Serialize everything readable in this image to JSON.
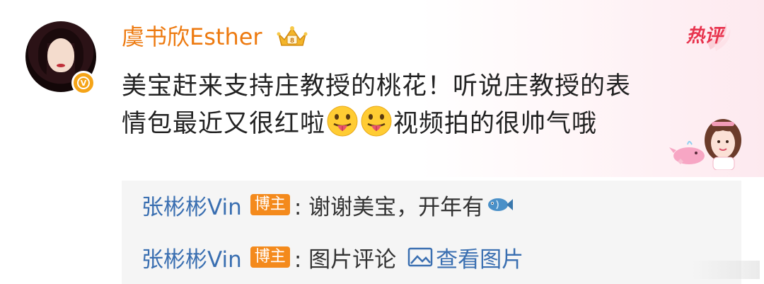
{
  "comment": {
    "username": "虞书欣Esther",
    "hot_badge": "热评",
    "text_line1": "美宝赶来支持庄教授的桃花！听说庄教授的表",
    "text_line2_a": "情包最近又很红啦",
    "text_line2_b": "视频拍的很帅气哦",
    "emoji": "tongue-out-emoji"
  },
  "replies": [
    {
      "name": "张彬彬Vin",
      "tag": "博主",
      "text": ": 谢谢美宝，开年有",
      "trailing_icon": "fish-icon"
    },
    {
      "name": "张彬彬Vin",
      "tag": "博主",
      "text": ": 图片评论",
      "link": "查看图片",
      "link_icon": "image-icon"
    }
  ],
  "colors": {
    "username": "#ed7a10",
    "reply_name": "#3a6fb1",
    "tag_bg": "#f48a1c",
    "hot": "#e8344e",
    "reply_bg": "#f5f5f5"
  }
}
